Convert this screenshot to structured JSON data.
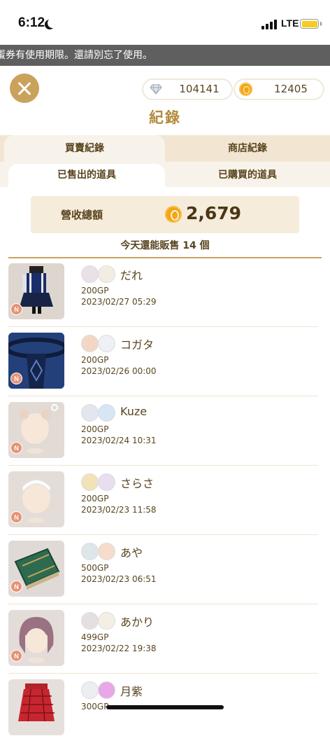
{
  "status": {
    "time": "6:12",
    "network": "LTE"
  },
  "notice": "蛋券有使用期限。還請別忘了使用。",
  "currency": {
    "diamonds": "104141",
    "gold": "12405"
  },
  "title": "紀錄",
  "tabs": {
    "buy_sell": "買賣紀錄",
    "shop": "商店紀錄"
  },
  "subtabs": {
    "sold": "已售出的道具",
    "bought": "已購買的道具"
  },
  "revenue": {
    "label": "營收總額",
    "value": "2,679"
  },
  "remaining": "今天還能販售 14 個",
  "badge": "N",
  "rows": [
    {
      "buyer": "だれ",
      "price": "200GP",
      "date": "2023/02/27 05:29"
    },
    {
      "buyer": "コガタ",
      "price": "200GP",
      "date": "2023/02/26 00:00"
    },
    {
      "buyer": "Kuze",
      "price": "200GP",
      "date": "2023/02/24 10:31"
    },
    {
      "buyer": "さらさ",
      "price": "200GP",
      "date": "2023/02/23 11:58"
    },
    {
      "buyer": "あや",
      "price": "500GP",
      "date": "2023/02/23 06:51"
    },
    {
      "buyer": "あかり",
      "price": "499GP",
      "date": "2023/02/22 19:38"
    },
    {
      "buyer": "月紫",
      "price": "300GP",
      "date": ""
    }
  ],
  "colors": {
    "accent": "#c9a35c",
    "text": "#5a4520",
    "tab_bg": "#f2e6d3",
    "badge": "#e69276"
  }
}
